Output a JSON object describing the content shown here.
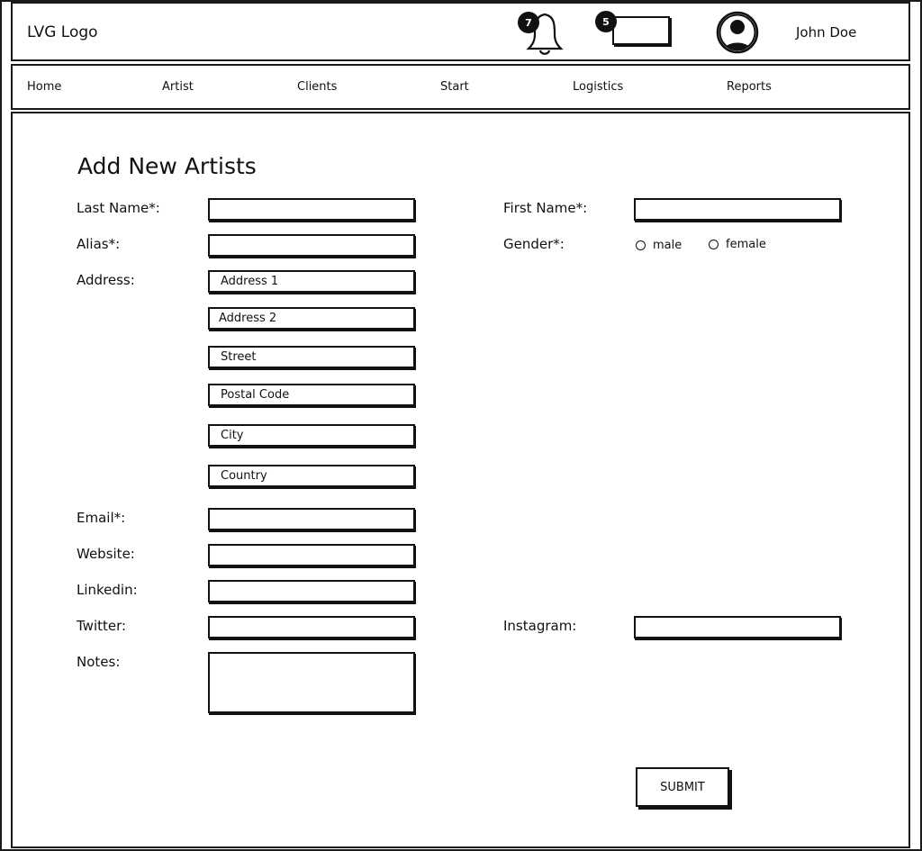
{
  "header": {
    "logo": "LVG Logo",
    "notifications_count": "7",
    "messages_count": "5",
    "user_name": "John Doe"
  },
  "nav": {
    "items": [
      {
        "label": "Home"
      },
      {
        "label": "Artist"
      },
      {
        "label": "Clients"
      },
      {
        "label": "Start"
      },
      {
        "label": "Logistics"
      },
      {
        "label": "Reports"
      }
    ]
  },
  "form": {
    "title": "Add New Artists",
    "last_name_label": "Last Name*:",
    "first_name_label": "First Name*:",
    "alias_label": "Alias*:",
    "gender_label": "Gender*:",
    "gender_options": [
      "male",
      "female"
    ],
    "address_label": "Address:",
    "address_placeholders": [
      "Address 1",
      "Address 2",
      "Street",
      "Postal Code",
      "City",
      "Country"
    ],
    "email_label": "Email*:",
    "website_label": "Website:",
    "linkedin_label": "Linkedin:",
    "twitter_label": "Twitter:",
    "instagram_label": "Instagram:",
    "notes_label": "Notes:",
    "submit_label": "SUBMIT"
  }
}
